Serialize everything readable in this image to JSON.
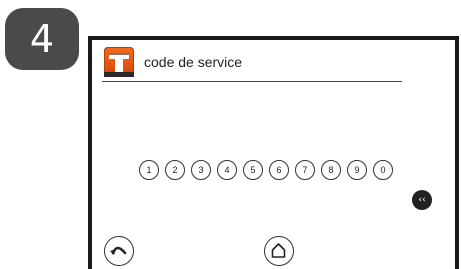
{
  "step": {
    "number": "4"
  },
  "header": {
    "title": "code de service",
    "logo_icon": "company-logo-icon",
    "logo_color": "#e25410"
  },
  "keypad": {
    "keys": [
      "1",
      "2",
      "3",
      "4",
      "5",
      "6",
      "7",
      "8",
      "9",
      "0"
    ],
    "backspace_label": "‹‹",
    "backspace_icon": "backspace-icon"
  },
  "footer": {
    "back_icon": "back-arrow-icon",
    "home_icon": "home-icon"
  }
}
